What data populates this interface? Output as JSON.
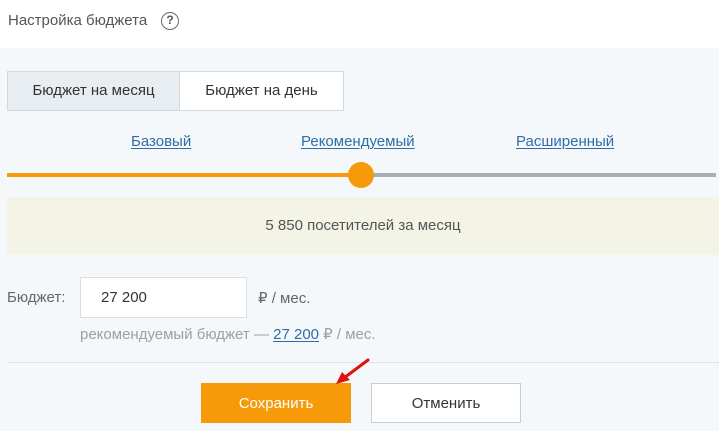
{
  "header": {
    "title": "Настройка бюджета",
    "help_icon_glyph": "?"
  },
  "tabs": [
    {
      "label": "Бюджет на месяц",
      "selected": true
    },
    {
      "label": "Бюджет на день",
      "selected": false
    }
  ],
  "levels": [
    {
      "label": "Базовый"
    },
    {
      "label": "Рекомендуемый"
    },
    {
      "label": "Расширенный"
    }
  ],
  "slider": {
    "selected_index": 1,
    "level_fraction": 0.5
  },
  "visitors": {
    "text": "5 850 посетителей за месяц"
  },
  "budget": {
    "label": "Бюджет:",
    "value": "27 200",
    "unit": "₽ / мес.",
    "recommend_prefix": "рекомендуемый бюджет — ",
    "recommend_value": "27 200",
    "recommend_suffix": " ₽ / мес."
  },
  "actions": {
    "save_label": "Сохранить",
    "cancel_label": "Отменить"
  },
  "colors": {
    "accent": "#f79a0a",
    "link": "#2f6da8",
    "panel_bg": "#f5f8fa",
    "info_bg": "#f3f3e6",
    "annotation_arrow": "#e01010"
  }
}
